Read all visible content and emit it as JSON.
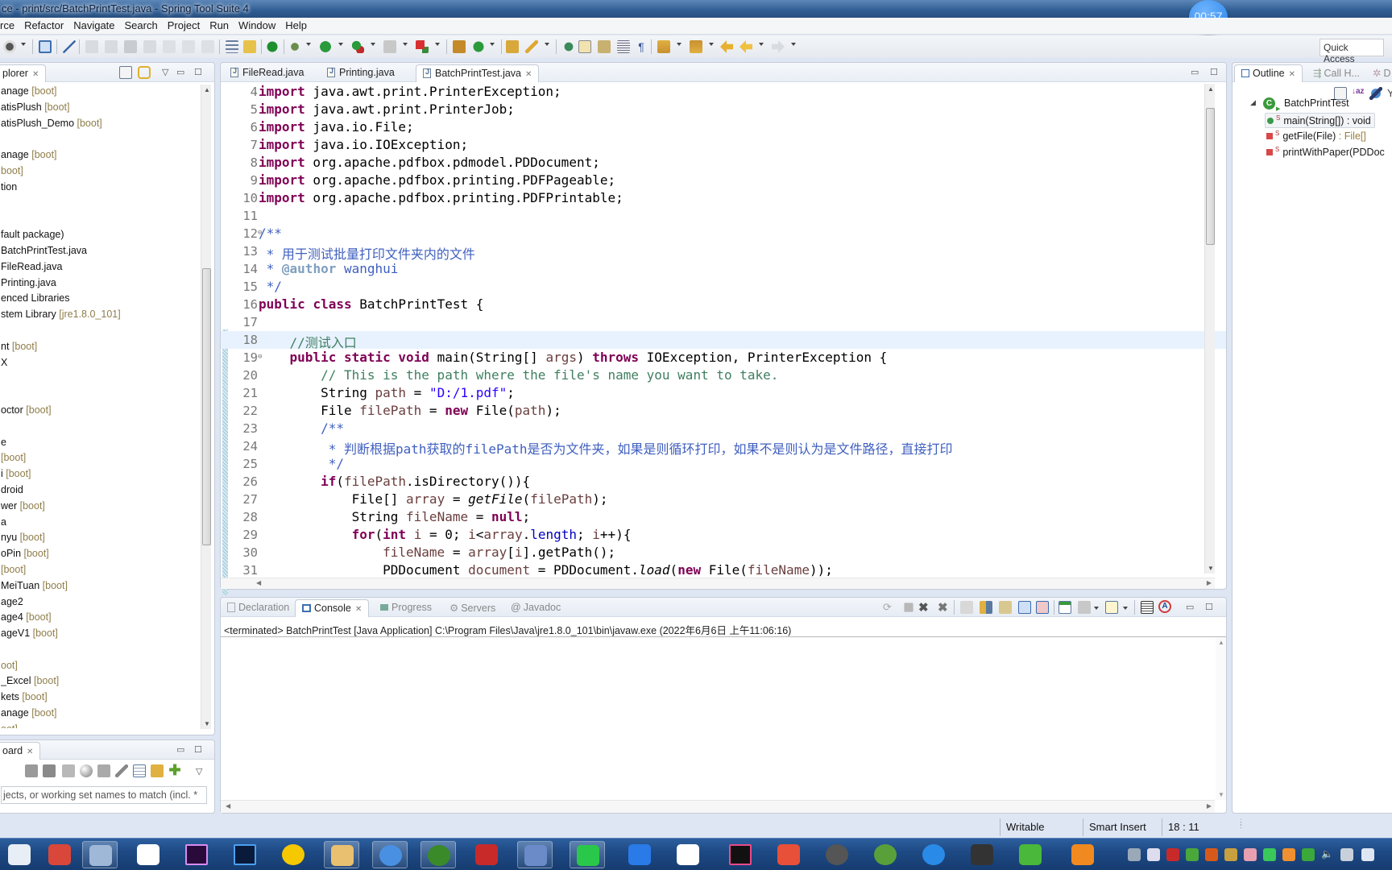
{
  "window": {
    "title": "ce - print/src/BatchPrintTest.java - Spring Tool Suite 4",
    "timer": "00:57"
  },
  "menu": [
    "rce",
    "Refactor",
    "Navigate",
    "Search",
    "Project",
    "Run",
    "Window",
    "Help"
  ],
  "toolbar": {
    "quick_access": "Quick Access"
  },
  "explorer": {
    "title": "plorer",
    "items": [
      {
        "name": "anage",
        "tag": "[boot]"
      },
      {
        "name": "atisPlush",
        "tag": "[boot]"
      },
      {
        "name": "atisPlush_Demo",
        "tag": "[boot]"
      },
      {
        "name": "",
        "tag": ""
      },
      {
        "name": "anage",
        "tag": "[boot]"
      },
      {
        "name": "",
        "tag": "boot]"
      },
      {
        "name": "tion",
        "tag": ""
      },
      {
        "name": "",
        "tag": ""
      },
      {
        "name": "",
        "tag": ""
      },
      {
        "name": "fault package)",
        "tag": ""
      },
      {
        "name": "BatchPrintTest.java",
        "tag": ""
      },
      {
        "name": "FileRead.java",
        "tag": ""
      },
      {
        "name": "Printing.java",
        "tag": ""
      },
      {
        "name": "enced Libraries",
        "tag": ""
      },
      {
        "name": "stem Library",
        "tag": "[jre1.8.0_101]"
      },
      {
        "name": "",
        "tag": ""
      },
      {
        "name": "nt",
        "tag": "[boot]"
      },
      {
        "name": "X",
        "tag": ""
      },
      {
        "name": "",
        "tag": ""
      },
      {
        "name": "",
        "tag": ""
      },
      {
        "name": "octor",
        "tag": "[boot]"
      },
      {
        "name": "",
        "tag": ""
      },
      {
        "name": "e",
        "tag": ""
      },
      {
        "name": "",
        "tag": "[boot]"
      },
      {
        "name": "i",
        "tag": "[boot]"
      },
      {
        "name": "droid",
        "tag": ""
      },
      {
        "name": "wer",
        "tag": "[boot]"
      },
      {
        "name": "a",
        "tag": ""
      },
      {
        "name": "nyu",
        "tag": "[boot]"
      },
      {
        "name": "oPin",
        "tag": "[boot]"
      },
      {
        "name": "",
        "tag": "[boot]"
      },
      {
        "name": "MeiTuan",
        "tag": "[boot]"
      },
      {
        "name": "age2",
        "tag": ""
      },
      {
        "name": "age4",
        "tag": "[boot]"
      },
      {
        "name": "ageV1",
        "tag": "[boot]"
      },
      {
        "name": "",
        "tag": ""
      },
      {
        "name": "",
        "tag": "oot]"
      },
      {
        "name": "_Excel",
        "tag": "[boot]"
      },
      {
        "name": "kets",
        "tag": "[boot]"
      },
      {
        "name": "anage",
        "tag": "[boot]"
      },
      {
        "name": "",
        "tag": "oot]"
      }
    ]
  },
  "dashboard": {
    "title": "oard",
    "filter_placeholder": "jects, or working set names to match (incl. *"
  },
  "editor": {
    "tabs": [
      {
        "label": "FileRead.java",
        "active": false
      },
      {
        "label": "Printing.java",
        "active": false
      },
      {
        "label": "BatchPrintTest.java",
        "active": true
      }
    ],
    "current_line": 18,
    "lines": [
      {
        "n": 4,
        "html": "<span class='kw'>import</span> java.awt.print.PrinterException;"
      },
      {
        "n": 5,
        "html": "<span class='kw'>import</span> java.awt.print.PrinterJob;"
      },
      {
        "n": 6,
        "html": "<span class='kw'>import</span> java.io.File;"
      },
      {
        "n": 7,
        "html": "<span class='kw'>import</span> java.io.IOException;"
      },
      {
        "n": 8,
        "html": "<span class='kw'>import</span> org.apache.pdfbox.pdmodel.PDDocument;"
      },
      {
        "n": 9,
        "html": "<span class='kw'>import</span> org.apache.pdfbox.printing.PDFPageable;"
      },
      {
        "n": 10,
        "html": "<span class='kw'>import</span> org.apache.pdfbox.printing.PDFPrintable;"
      },
      {
        "n": 11,
        "html": ""
      },
      {
        "n": 12,
        "html": "<span class='jd'>/**</span>",
        "fold": true
      },
      {
        "n": 13,
        "html": "<span class='jd'> * 用于测试批量打印文件夹内的文件</span>"
      },
      {
        "n": 14,
        "html": "<span class='jd'> * </span><span class='tag'>@author</span><span class='jd'> wanghui</span>"
      },
      {
        "n": 15,
        "html": "<span class='jd'> */</span>"
      },
      {
        "n": 16,
        "html": "<span class='kw'>public</span> <span class='kw'>class</span> BatchPrintTest {"
      },
      {
        "n": 17,
        "html": ""
      },
      {
        "n": 18,
        "html": "    <span class='cm'>//测试入口</span>"
      },
      {
        "n": 19,
        "html": "    <span class='kw'>public</span> <span class='kw'>static</span> <span class='kw'>void</span> main(String[] <span class='var'>args</span>) <span class='kw'>throws</span> IOException, PrinterException {",
        "fold": true
      },
      {
        "n": 20,
        "html": "        <span class='cm'>// This is the path where the file's name you want to take.</span>"
      },
      {
        "n": 21,
        "html": "        String <span class='var'>path</span> = <span class='str'>\"D:/1.pdf\"</span>;"
      },
      {
        "n": 22,
        "html": "        File <span class='var'>filePath</span> = <span class='kw'>new</span> File(<span class='var'>path</span>);"
      },
      {
        "n": 23,
        "html": "        <span class='jd'>/**</span>"
      },
      {
        "n": 24,
        "html": "<span class='jd'>         * 判断根据path获取的filePath是否为文件夹，如果是则循环打印，如果不是则认为是文件路径，直接打印</span>"
      },
      {
        "n": 25,
        "html": "<span class='jd'>         */</span>"
      },
      {
        "n": 26,
        "html": "        <span class='kw'>if</span>(<span class='var'>filePath</span>.isDirectory()){"
      },
      {
        "n": 27,
        "html": "            File[] <span class='var'>array</span> = <span class='it'>getFile</span>(<span class='var'>filePath</span>);"
      },
      {
        "n": 28,
        "html": "            String <span class='var'>fileName</span> = <span class='kw'>null</span>;"
      },
      {
        "n": 29,
        "html": "            <span class='kw'>for</span>(<span class='kw'>int</span> <span class='var'>i</span> = 0; <span class='var'>i</span>&lt;<span class='var'>array</span>.<span class='fld'>length</span>; <span class='var'>i</span>++){"
      },
      {
        "n": 30,
        "html": "                <span class='var'>fileName</span> = <span class='var'>array</span>[<span class='var'>i</span>].getPath();"
      },
      {
        "n": 31,
        "html": "                PDDocument <span class='var'>document</span> = PDDocument.<span class='it'>load</span>(<span class='kw'>new</span> File(<span class='var'>fileName</span>));"
      }
    ]
  },
  "outline": {
    "tabs": [
      "Outline",
      "Call H...",
      "D"
    ],
    "class_name": "BatchPrintTest",
    "members": [
      {
        "label": "main(String[]) : void",
        "type": "",
        "visibility": "public",
        "selected": true
      },
      {
        "label": "getFile(File)",
        "type": " : File[]",
        "visibility": "private",
        "selected": false
      },
      {
        "label": "printWithPaper(PDDoc",
        "type": "",
        "visibility": "private",
        "selected": false
      }
    ]
  },
  "bottom_panel": {
    "tabs": [
      "Declaration",
      "Console",
      "Progress",
      "Servers",
      "Javadoc"
    ],
    "active_tab": "Console",
    "console_header": "<terminated> BatchPrintTest [Java Application] C:\\Program Files\\Java\\jre1.8.0_101\\bin\\javaw.exe (2022年6月6日 上午11:06:16)"
  },
  "status": {
    "writable": "Writable",
    "insert_mode": "Smart Insert",
    "position": "18 : 11"
  },
  "taskbar": {
    "apps": [
      "calendar",
      "notes-add",
      "notepad",
      "baidu-netdisk",
      "premiere",
      "photoshop",
      "qq-music",
      "file-explorer",
      "chrome-like",
      "spring-tool-suite",
      "wps",
      "mysql-workbench",
      "wechat",
      "dingtalk-like",
      "xmind-like",
      "intellij-idea",
      "app-orange",
      "obs-like",
      "spring-leaf",
      "app-blue",
      "remote-desktop",
      "thunder",
      "video-recorder"
    ]
  }
}
